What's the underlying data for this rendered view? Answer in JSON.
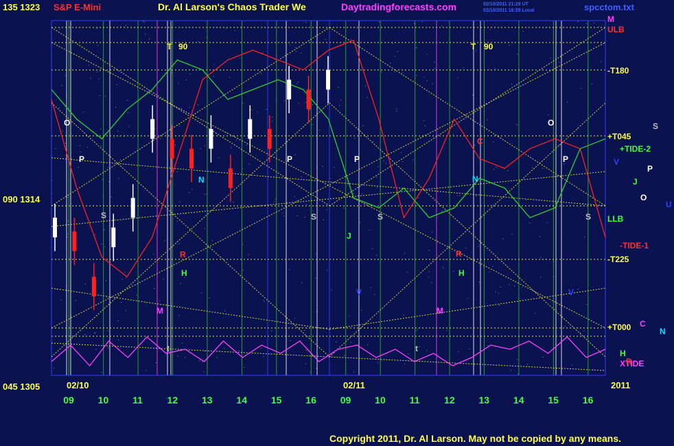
{
  "header": {
    "left_title": "S&P E-Mini",
    "top_price_label": "135  1323",
    "center_title": "Dr. Al Larson's Chaos Trader We",
    "site": "Daytradingforecasts.com",
    "stamp_line1": "02/10/2011 21:29 UT",
    "stamp_line2": "02/10/2011 16:29 Local",
    "file_name": "spcctom.txt"
  },
  "left_axis": {
    "top": "135  1323",
    "mid": "090  1314",
    "bottom": "045  1305"
  },
  "right_labels": [
    {
      "text": "M",
      "color": "#ff40ff"
    },
    {
      "text": "ULB",
      "color": "#ff3030"
    },
    {
      "text": "-T180",
      "color": "#ffff40"
    },
    {
      "text": "+T045",
      "color": "#ffff40"
    },
    {
      "text": "+TIDE-2",
      "color": "#40ff40"
    },
    {
      "text": "LLB",
      "color": "#40ff40"
    },
    {
      "text": "-TIDE-1",
      "color": "#ff3030"
    },
    {
      "text": "-T225",
      "color": "#ffff40"
    },
    {
      "text": "+T000",
      "color": "#ffff40"
    },
    {
      "text": "XTIDE",
      "color": "#ff40ff"
    }
  ],
  "far_right_letters": [
    {
      "text": "S",
      "color": "#c0c0c0"
    },
    {
      "text": "V",
      "color": "#3040ff"
    },
    {
      "text": "P",
      "color": "#ffffff"
    },
    {
      "text": "J",
      "color": "#40ff40"
    },
    {
      "text": "O",
      "color": "#ffffff"
    },
    {
      "text": "U",
      "color": "#3040ff"
    },
    {
      "text": "C",
      "color": "#ff40ff"
    },
    {
      "text": "N",
      "color": "#00e0ff"
    },
    {
      "text": "H",
      "color": "#40ff40"
    },
    {
      "text": "R",
      "color": "#ff3030"
    }
  ],
  "planet_markers": [
    {
      "text": "T",
      "color": "#ffff40"
    },
    {
      "text": "90",
      "color": "#ffff40"
    },
    {
      "text": "O",
      "color": "#ffffff"
    },
    {
      "text": "P",
      "color": "#ffffff"
    },
    {
      "text": "S",
      "color": "#c0c0c0"
    },
    {
      "text": "N",
      "color": "#00e0ff"
    },
    {
      "text": "R",
      "color": "#ff3030"
    },
    {
      "text": "H",
      "color": "#40ff40"
    },
    {
      "text": "M",
      "color": "#ff40ff"
    },
    {
      "text": "t",
      "color": "#c0c0c0"
    },
    {
      "text": "P",
      "color": "#ffffff"
    },
    {
      "text": "S",
      "color": "#c0c0c0"
    },
    {
      "text": "J",
      "color": "#40ff40"
    },
    {
      "text": "V",
      "color": "#3040ff"
    },
    {
      "text": "P",
      "color": "#ffffff"
    },
    {
      "text": "S",
      "color": "#c0c0c0"
    },
    {
      "text": "C",
      "color": "#ff3030"
    },
    {
      "text": "N",
      "color": "#00e0ff"
    },
    {
      "text": "R",
      "color": "#ff3030"
    },
    {
      "text": "H",
      "color": "#40ff40"
    },
    {
      "text": "M",
      "color": "#ff40ff"
    },
    {
      "text": "t",
      "color": "#c0c0c0"
    },
    {
      "text": "T",
      "color": "#ffff40"
    },
    {
      "text": "90",
      "color": "#ffff40"
    },
    {
      "text": "O",
      "color": "#ffffff"
    },
    {
      "text": "P",
      "color": "#ffffff"
    },
    {
      "text": "S",
      "color": "#c0c0c0"
    },
    {
      "text": "V",
      "color": "#3040ff"
    }
  ],
  "x_axis": {
    "date_left": "02/10",
    "date_right": "02/11",
    "year": "2011",
    "hours": [
      "09",
      "10",
      "11",
      "12",
      "13",
      "14",
      "15",
      "16",
      "09",
      "10",
      "11",
      "12",
      "13",
      "14",
      "15",
      "16"
    ]
  },
  "copyright": "Copyright 2011, Dr. Al Larson. May not be copied by any means.",
  "colors": {
    "background": "#0a1250",
    "grid_yellow": "#e8e840",
    "grid_green": "#30c030",
    "magenta": "#ff40ff",
    "red": "#ff2020",
    "green_line": "#30d030",
    "price_white": "#ffffff"
  },
  "chart_data": {
    "type": "line",
    "title": "S&P E-Mini",
    "y_labels": [
      "1323",
      "1314",
      "1305"
    ],
    "ylim": [
      1305,
      1323
    ],
    "degree_labels": [
      "135",
      "090",
      "045"
    ],
    "x": [
      "09",
      "10",
      "11",
      "12",
      "13",
      "14",
      "15",
      "16",
      "09",
      "10",
      "11",
      "12",
      "13",
      "14",
      "15",
      "16"
    ],
    "series": [
      {
        "name": "price",
        "color": "#ffffff",
        "values": [
          1312.5,
          1311.8,
          1309.5,
          1312.0,
          1313.5,
          1317.5,
          1316.5,
          1316.0,
          1317.0,
          1315.0,
          1317.5,
          1317.0,
          1319.5,
          1319.0,
          1320.0
        ]
      },
      {
        "name": "TIDE-1",
        "color": "#ff2020",
        "values": [
          1319.0,
          1314.5,
          1311.0,
          1310.0,
          1312.0,
          1316.0,
          1320.0,
          1321.0,
          1321.5,
          1321.0,
          1320.5,
          1321.5,
          1322.0,
          1318.0,
          1313.0,
          1315.0,
          1318.0,
          1316.0,
          1315.5,
          1316.5,
          1317.0,
          1316.5,
          1312.0
        ]
      },
      {
        "name": "TIDE-2",
        "color": "#30d030",
        "values": [
          1319.5,
          1318.0,
          1317.0,
          1318.5,
          1319.5,
          1321.0,
          1320.5,
          1319.0,
          1319.5,
          1320.0,
          1319.5,
          1318.0,
          1314.0,
          1313.5,
          1314.5,
          1313.0,
          1313.5,
          1315.0,
          1314.5,
          1313.0,
          1313.5,
          1316.5,
          1317.0
        ]
      },
      {
        "name": "XTIDE",
        "color": "#ff40ff",
        "values": [
          0.3,
          0.7,
          0.2,
          0.8,
          0.4,
          0.9,
          0.5,
          0.6,
          0.3,
          0.8,
          0.4,
          0.7,
          0.5,
          0.8,
          0.3,
          0.6,
          0.7,
          0.4,
          0.6,
          0.3,
          0.5,
          0.2,
          0.4,
          0.7,
          0.6,
          0.8,
          0.5,
          0.9,
          0.4,
          0.6
        ]
      }
    ]
  }
}
